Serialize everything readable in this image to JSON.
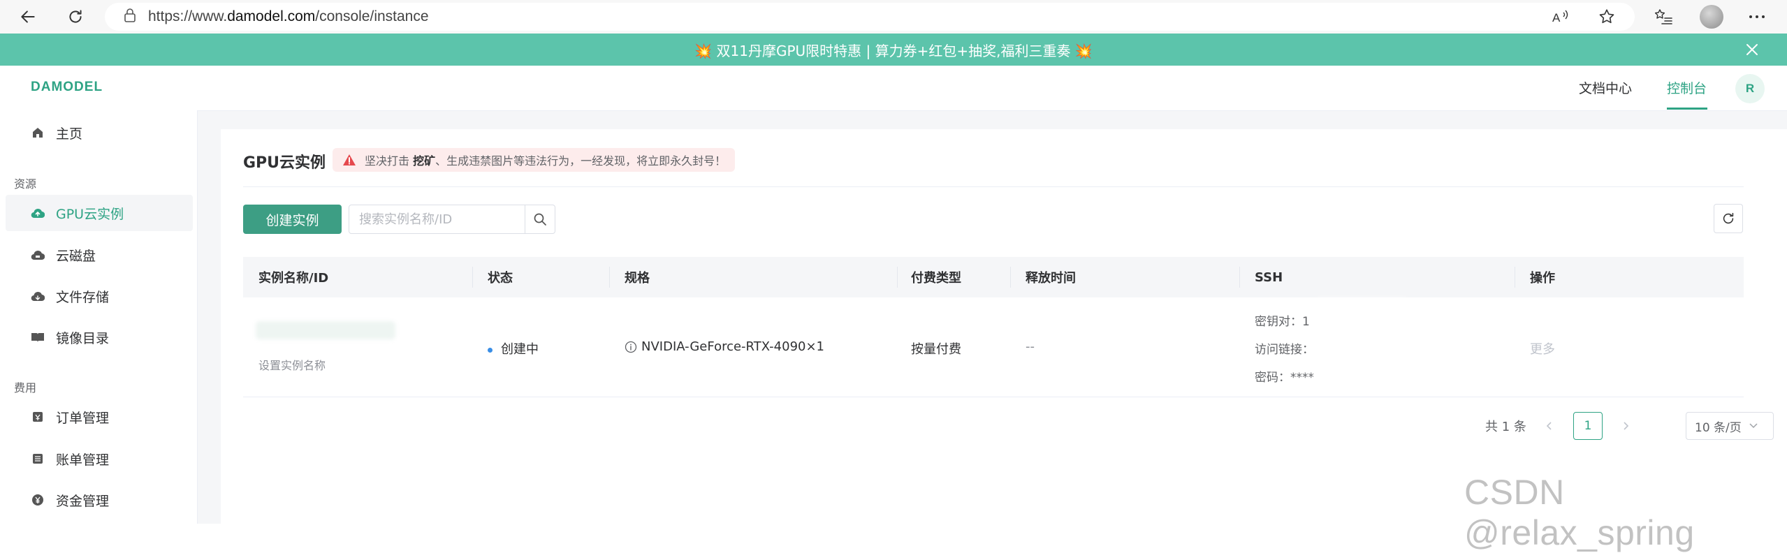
{
  "browser": {
    "url_prefix": "https://www.",
    "url_host": "damodel.com",
    "url_path": "/console/instance"
  },
  "promo": {
    "text": "💥 双11丹摩GPU限时特惠 | 算力券+红包+抽奖,福利三重奏 💥"
  },
  "header": {
    "logo": "DAMODEL",
    "nav": [
      "文档中心",
      "控制台"
    ],
    "active_nav": "控制台",
    "user_initial": "R"
  },
  "sidebar": {
    "home": "主页",
    "section_resources": "资源",
    "items_resources": [
      "GPU云实例",
      "云磁盘",
      "文件存储",
      "镜像目录"
    ],
    "section_billing": "费用",
    "items_billing": [
      "订单管理",
      "账单管理",
      "资金管理"
    ],
    "active_item": "GPU云实例"
  },
  "main": {
    "title": "GPU云实例",
    "warning_prefix": "坚决打击 ",
    "warning_bold": "挖矿",
    "warning_suffix": "、生成违禁图片等违法行为，一经发现，将立即永久封号！",
    "create_button": "创建实例",
    "search_placeholder": "搜索实例名称/ID"
  },
  "table": {
    "columns": [
      "实例名称/ID",
      "状态",
      "规格",
      "付费类型",
      "释放时间",
      "SSH",
      "操作"
    ],
    "rows": [
      {
        "name_hint": "设置实例名称",
        "status": "创建中",
        "spec": "NVIDIA-GeForce-RTX-4090×1",
        "billing": "按量付费",
        "release": "--",
        "ssh_key_label": "密钥对：",
        "ssh_key_value": "1",
        "ssh_link_label": "访问链接：",
        "ssh_password_label": "密码：",
        "ssh_password_value": "****",
        "action": "更多"
      }
    ]
  },
  "pagination": {
    "total": "共 1 条",
    "current_page": "1",
    "page_size": "10 条/页"
  },
  "watermark": "CSDN @relax_spring",
  "colors": {
    "accent": "#2ea384",
    "button": "#3d9e84",
    "promo": "#5cc4ab",
    "status_dot": "#3a8ee6"
  }
}
